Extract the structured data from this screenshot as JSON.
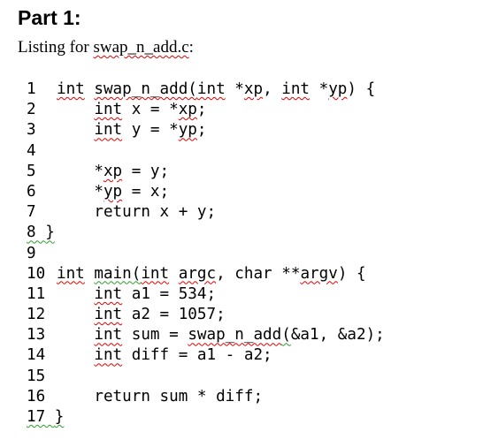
{
  "heading": "Part 1:",
  "caption": {
    "prefix": "Listing for ",
    "filename": "swap_n_add.c",
    "suffix": ":"
  },
  "listing": {
    "lines": [
      {
        "num": "1",
        "segments": [
          {
            "t": "int",
            "m": "red"
          },
          {
            "t": " "
          },
          {
            "t": "swap_n_add(",
            "m": "red"
          },
          {
            "t": "int",
            "m": "red"
          },
          {
            "t": " *"
          },
          {
            "t": "xp",
            "m": "red"
          },
          {
            "t": ", "
          },
          {
            "t": "int",
            "m": "red"
          },
          {
            "t": " *"
          },
          {
            "t": "yp",
            "m": "red"
          },
          {
            "t": ") {"
          }
        ]
      },
      {
        "num": "2",
        "segments": [
          {
            "t": "    "
          },
          {
            "t": "int",
            "m": "red"
          },
          {
            "t": " x = *"
          },
          {
            "t": "xp",
            "m": "red"
          },
          {
            "t": ";"
          }
        ]
      },
      {
        "num": "3",
        "segments": [
          {
            "t": "    "
          },
          {
            "t": "int",
            "m": "red"
          },
          {
            "t": " y = *"
          },
          {
            "t": "yp",
            "m": "red"
          },
          {
            "t": ";"
          }
        ]
      },
      {
        "num": "4",
        "segments": []
      },
      {
        "num": "5",
        "segments": [
          {
            "t": "    *"
          },
          {
            "t": "xp",
            "m": "red"
          },
          {
            "t": " = y;"
          }
        ]
      },
      {
        "num": "6",
        "segments": [
          {
            "t": "    *"
          },
          {
            "t": "yp",
            "m": "red"
          },
          {
            "t": " = x;"
          }
        ]
      },
      {
        "num": "7",
        "segments": [
          {
            "t": "    return x + y;"
          }
        ]
      },
      {
        "num": "8",
        "num_mark": "green",
        "segments": [
          {
            "t": "}",
            "m": "green"
          }
        ]
      },
      {
        "num": "9",
        "segments": []
      },
      {
        "num": "10",
        "segments": [
          {
            "t": "int",
            "m": "red"
          },
          {
            "t": " "
          },
          {
            "t": "main(",
            "m": "green"
          },
          {
            "t": "int",
            "m": "red"
          },
          {
            "t": " "
          },
          {
            "t": "argc",
            "m": "red"
          },
          {
            "t": ", char **"
          },
          {
            "t": "argv",
            "m": "red"
          },
          {
            "t": ") {"
          }
        ]
      },
      {
        "num": "11",
        "segments": [
          {
            "t": "    "
          },
          {
            "t": "int",
            "m": "red"
          },
          {
            "t": " a1 = 534;"
          }
        ]
      },
      {
        "num": "12",
        "segments": [
          {
            "t": "    "
          },
          {
            "t": "int",
            "m": "red"
          },
          {
            "t": " a2 = 1057;"
          }
        ]
      },
      {
        "num": "13",
        "segments": [
          {
            "t": "    "
          },
          {
            "t": "int",
            "m": "red"
          },
          {
            "t": " sum = "
          },
          {
            "t": "swap_n_add",
            "m": "red"
          },
          {
            "t": "(",
            "m": "green"
          },
          {
            "t": "&a1, &a2);"
          }
        ]
      },
      {
        "num": "14",
        "segments": [
          {
            "t": "    "
          },
          {
            "t": "int",
            "m": "red"
          },
          {
            "t": " diff = a1 - a2;"
          }
        ]
      },
      {
        "num": "15",
        "segments": []
      },
      {
        "num": "16",
        "segments": [
          {
            "t": "    return sum * diff;"
          }
        ]
      },
      {
        "num": "17",
        "num_mark": "green",
        "segments": [
          {
            "t": "}",
            "m": "green"
          }
        ]
      }
    ]
  }
}
